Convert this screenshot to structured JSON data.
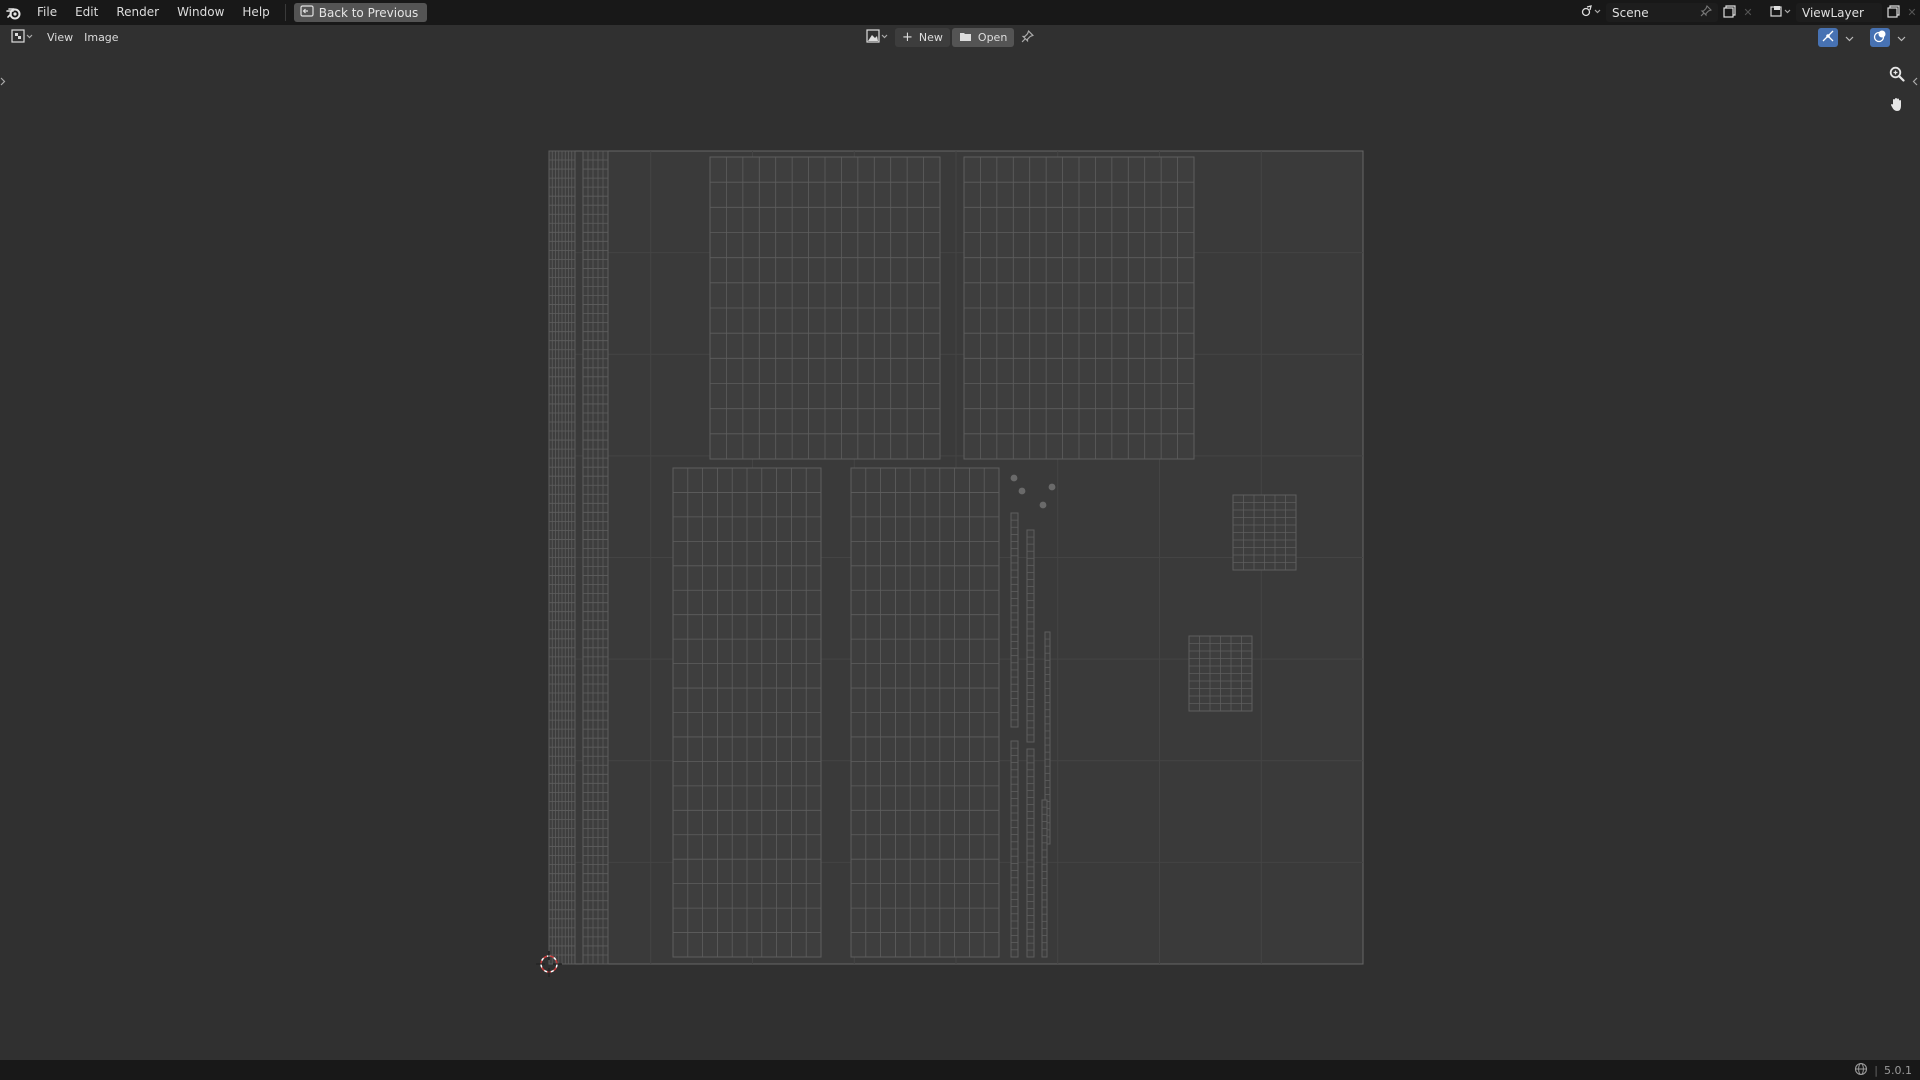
{
  "menu": {
    "items": [
      "File",
      "Edit",
      "Render",
      "Window",
      "Help"
    ],
    "back_label": "Back to Previous"
  },
  "topbar_right": {
    "scene_name": "Scene",
    "view_layer_name": "ViewLayer"
  },
  "editor_header": {
    "menus": [
      "View",
      "Image"
    ],
    "new_label": "New",
    "open_label": "Open"
  },
  "status": {
    "version": "5.0.1"
  },
  "colors": {
    "accent": "#4772b3",
    "topbar_bg": "#181818",
    "viewport_bg": "#303030",
    "uv_bg": "#3a3a3a",
    "uv_line": "#5e5e5e",
    "cursor_red": "#c83c3c"
  },
  "icons": {
    "logo": "blender-logo-icon",
    "back": "back-to-previous-icon",
    "scene": "scene-icon",
    "pin": "pin-icon",
    "copy": "duplicate-icon",
    "close": "close-icon",
    "viewlayer": "view-layer-icon",
    "editor_type": "image-editor-icon",
    "image_browse": "image-browse-icon",
    "new": "plus-icon",
    "open": "folder-icon",
    "zoom": "zoom-icon",
    "pan": "hand-icon",
    "overlay": "overlay-icon",
    "gizmo": "gizmo-icon",
    "network": "network-icon"
  }
}
